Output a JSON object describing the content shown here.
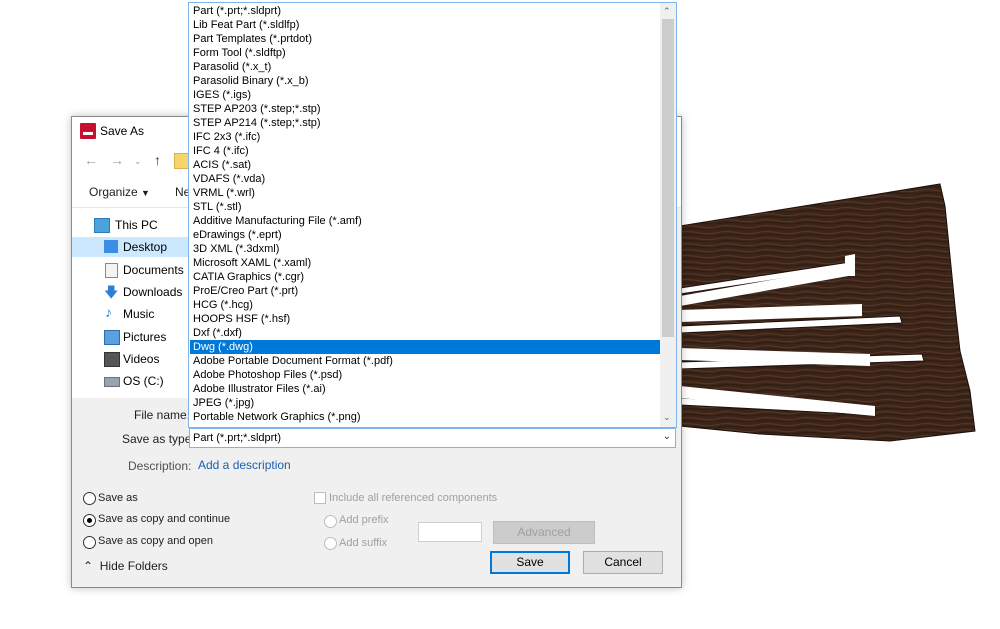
{
  "dialog": {
    "title": "Save As",
    "organize_label": "Organize",
    "new_folder_label": "Ne",
    "nav_items": [
      {
        "label": "This PC",
        "icon": "computer-icon"
      },
      {
        "label": "Desktop",
        "icon": "desktop-icon",
        "selected": true
      },
      {
        "label": "Documents",
        "icon": "documents-icon"
      },
      {
        "label": "Downloads",
        "icon": "downloads-icon"
      },
      {
        "label": "Music",
        "icon": "music-icon"
      },
      {
        "label": "Pictures",
        "icon": "pictures-icon"
      },
      {
        "label": "Videos",
        "icon": "videos-icon"
      },
      {
        "label": "OS (C:)",
        "icon": "drive-icon"
      }
    ],
    "file_name_label": "File name:",
    "save_as_type_label": "Save as type:",
    "save_as_type_value": "Part (*.prt;*.sldprt)",
    "description_label": "Description:",
    "add_description": "Add a description",
    "radio_save_as": "Save as",
    "radio_save_copy_continue": "Save as copy and continue",
    "radio_save_copy_open": "Save as copy and open",
    "include_components": "Include all referenced components",
    "add_prefix": "Add prefix",
    "add_suffix": "Add suffix",
    "advanced_label": "Advanced",
    "save_label": "Save",
    "cancel_label": "Cancel",
    "hide_folders": "Hide Folders"
  },
  "dropdown": {
    "options": [
      "Part (*.prt;*.sldprt)",
      "Lib Feat Part (*.sldlfp)",
      "Part Templates (*.prtdot)",
      "Form Tool (*.sldftp)",
      "Parasolid (*.x_t)",
      "Parasolid Binary (*.x_b)",
      "IGES (*.igs)",
      "STEP AP203 (*.step;*.stp)",
      "STEP AP214 (*.step;*.stp)",
      "IFC 2x3 (*.ifc)",
      "IFC 4 (*.ifc)",
      "ACIS (*.sat)",
      "VDAFS (*.vda)",
      "VRML (*.wrl)",
      "STL (*.stl)",
      "Additive Manufacturing File (*.amf)",
      "eDrawings (*.eprt)",
      "3D XML (*.3dxml)",
      "Microsoft XAML (*.xaml)",
      "CATIA Graphics (*.cgr)",
      "ProE/Creo Part (*.prt)",
      "HCG (*.hcg)",
      "HOOPS HSF (*.hsf)",
      "Dxf (*.dxf)",
      "Dwg (*.dwg)",
      "Adobe Portable Document Format (*.pdf)",
      "Adobe Photoshop Files (*.psd)",
      "Adobe Illustrator Files (*.ai)",
      "JPEG (*.jpg)",
      "Portable Network Graphics (*.png)"
    ],
    "highlighted": "Dwg (*.dwg)"
  },
  "colors": {
    "accent": "#0078d7",
    "wood": "#3b2418"
  }
}
